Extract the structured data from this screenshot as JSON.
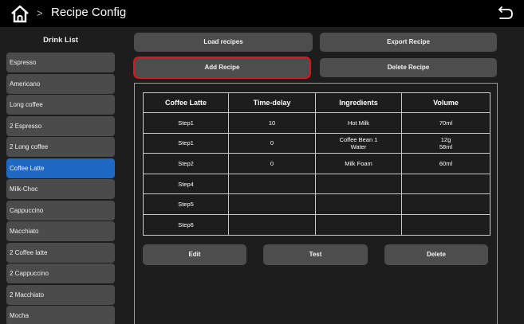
{
  "header": {
    "breadcrumb_sep": ">",
    "title": "Recipe Config"
  },
  "sidebar": {
    "title": "Drink List",
    "items": [
      {
        "label": "Espresso"
      },
      {
        "label": "Americano"
      },
      {
        "label": "Long coffee"
      },
      {
        "label": "2 Espresso"
      },
      {
        "label": "2 Long coffee"
      },
      {
        "label": "Coffee Latte",
        "selected": true
      },
      {
        "label": "Milk-Choc"
      },
      {
        "label": "Cappuccino"
      },
      {
        "label": "Macchiato"
      },
      {
        "label": "2 Coffee latte"
      },
      {
        "label": "2 Cappuccino"
      },
      {
        "label": "2 Macchiato"
      },
      {
        "label": "Mocha"
      }
    ]
  },
  "actions": {
    "load": "Load recipes",
    "export": "Export Recipe",
    "add": "Add Recipe",
    "delete_recipe": "Delete Recipe"
  },
  "table": {
    "columns": [
      "Coffee Latte",
      "Time-delay",
      "Ingredients",
      "Volume"
    ],
    "rows": [
      {
        "step": "Step1",
        "delay": "10",
        "ingredients": [
          "Hot Milk"
        ],
        "volume": [
          "70ml"
        ]
      },
      {
        "step": "Step1",
        "delay": "0",
        "ingredients": [
          "Coffee Bean 1",
          "Water"
        ],
        "volume": [
          "12g",
          "58ml"
        ]
      },
      {
        "step": "Step2",
        "delay": "0",
        "ingredients": [
          "Milk Foam"
        ],
        "volume": [
          "60ml"
        ]
      },
      {
        "step": "Step4",
        "delay": "",
        "ingredients": [
          ""
        ],
        "volume": [
          ""
        ]
      },
      {
        "step": "Step5",
        "delay": "",
        "ingredients": [
          ""
        ],
        "volume": [
          ""
        ]
      },
      {
        "step": "Step6",
        "delay": "",
        "ingredients": [
          ""
        ],
        "volume": [
          ""
        ]
      }
    ]
  },
  "bottom_actions": {
    "edit": "Edit",
    "test": "Test",
    "delete": "Delete"
  },
  "colors": {
    "selected": "#1f68c3",
    "highlight_border": "#e0141c",
    "button": "#4d4d4d"
  }
}
